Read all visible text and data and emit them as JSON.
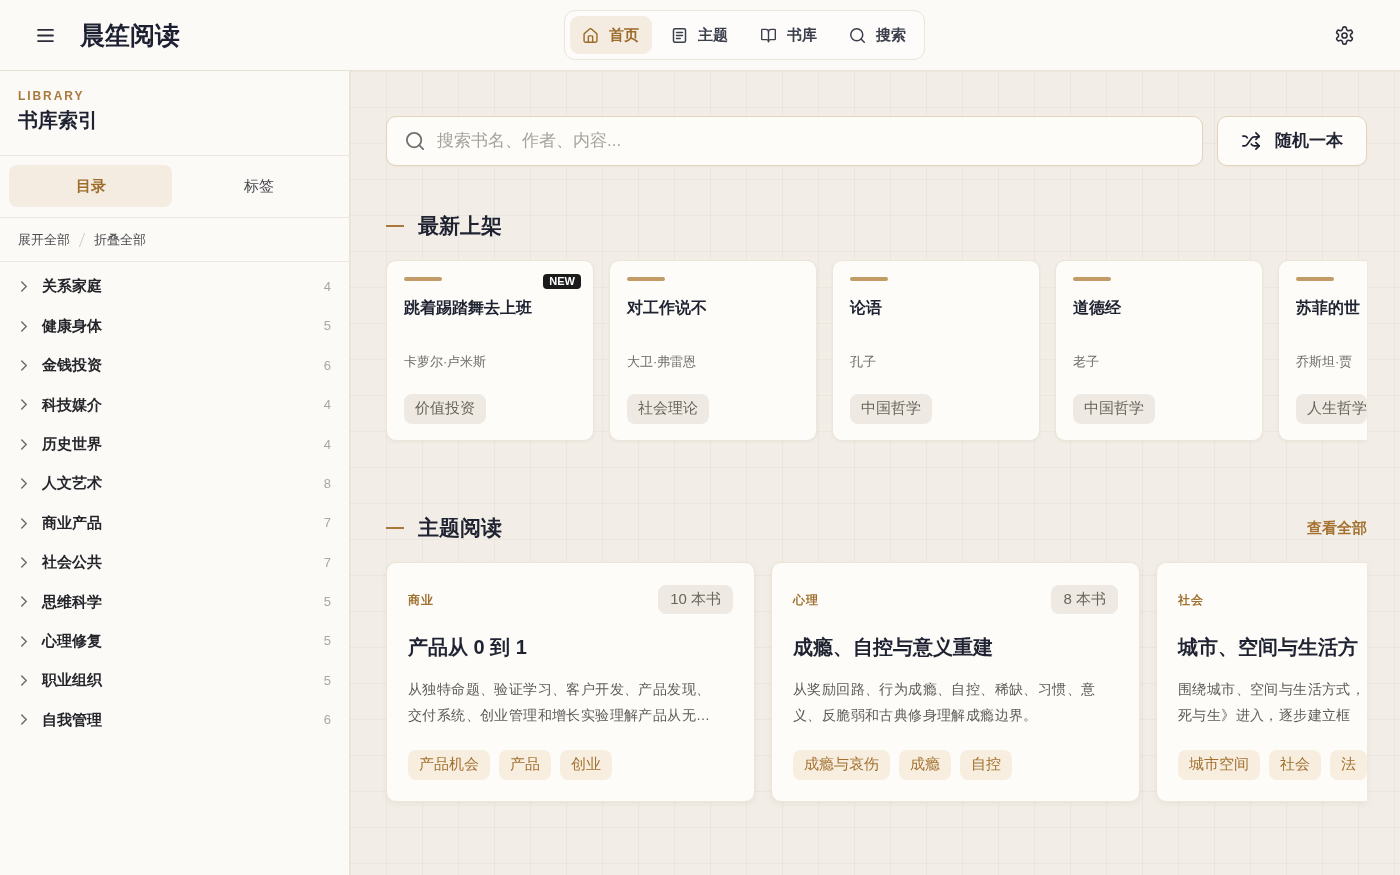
{
  "header": {
    "title": "晨笙阅读",
    "nav_tabs": [
      {
        "label": "首页",
        "selected": true
      },
      {
        "label": "主题",
        "selected": false
      },
      {
        "label": "书库",
        "selected": false
      },
      {
        "label": "搜索",
        "selected": false
      }
    ]
  },
  "sidebar": {
    "eyebrow": "LIBRARY",
    "title": "书库索引",
    "tabs": [
      {
        "label": "目录",
        "selected": true
      },
      {
        "label": "标签",
        "selected": false
      }
    ],
    "actions": [
      "展开全部",
      "折叠全部"
    ],
    "categories": [
      {
        "label": "关系家庭",
        "count": "4",
        "expanded": false
      },
      {
        "label": "健康身体",
        "count": "5",
        "expanded": false
      },
      {
        "label": "金钱投资",
        "count": "6",
        "expanded": false
      },
      {
        "label": "科技媒介",
        "count": "4",
        "expanded": false
      },
      {
        "label": "历史世界",
        "count": "4",
        "expanded": false
      },
      {
        "label": "人文艺术",
        "count": "8",
        "expanded": false
      },
      {
        "label": "商业产品",
        "count": "7",
        "expanded": false
      },
      {
        "label": "社会公共",
        "count": "7",
        "expanded": false
      },
      {
        "label": "思维科学",
        "count": "5",
        "expanded": false
      },
      {
        "label": "心理修复",
        "count": "5",
        "expanded": false
      },
      {
        "label": "职业组织",
        "count": "5",
        "expanded": false
      },
      {
        "label": "自我管理",
        "count": "6",
        "expanded": false
      }
    ]
  },
  "main": {
    "search": {
      "placeholder": "搜索书名、作者、内容..."
    },
    "random_button": "随机一本",
    "latest": {
      "title": "最新上架",
      "books": [
        {
          "title": "跳着踢踏舞去上班",
          "author": "卡萝尔·卢米斯",
          "tag": "价值投资",
          "badge": "NEW"
        },
        {
          "title": "对工作说不",
          "author": "大卫·弗雷恩",
          "tag": "社会理论"
        },
        {
          "title": "论语",
          "author": "孔子",
          "tag": "中国哲学"
        },
        {
          "title": "道德经",
          "author": "老子",
          "tag": "中国哲学"
        },
        {
          "title": "苏菲的世",
          "author": "乔斯坦·贾",
          "tag": "人生哲学"
        }
      ]
    },
    "themes": {
      "title": "主题阅读",
      "link": "查看全部",
      "cards": [
        {
          "category": "商业",
          "count": "10 本书",
          "title": "产品从 0 到 1",
          "description": "从独特命题、验证学习、客户开发、产品发现、交付系统、创业管理和增长实验理解产品从无…",
          "tags": [
            "产品机会",
            "产品",
            "创业"
          ]
        },
        {
          "category": "心理",
          "count": "8 本书",
          "title": "成瘾、自控与意义重建",
          "description": "从奖励回路、行为成瘾、自控、稀缺、习惯、意义、反脆弱和古典修身理解成瘾边界。",
          "tags": [
            "成瘾与哀伤",
            "成瘾",
            "自控"
          ]
        },
        {
          "category": "社会",
          "title": "城市、空间与生活方",
          "description": "围绕城市、空间与生活方式，死与生》进入，逐步建立框",
          "tags": [
            "城市空间",
            "社会",
            "法"
          ]
        }
      ]
    }
  }
}
